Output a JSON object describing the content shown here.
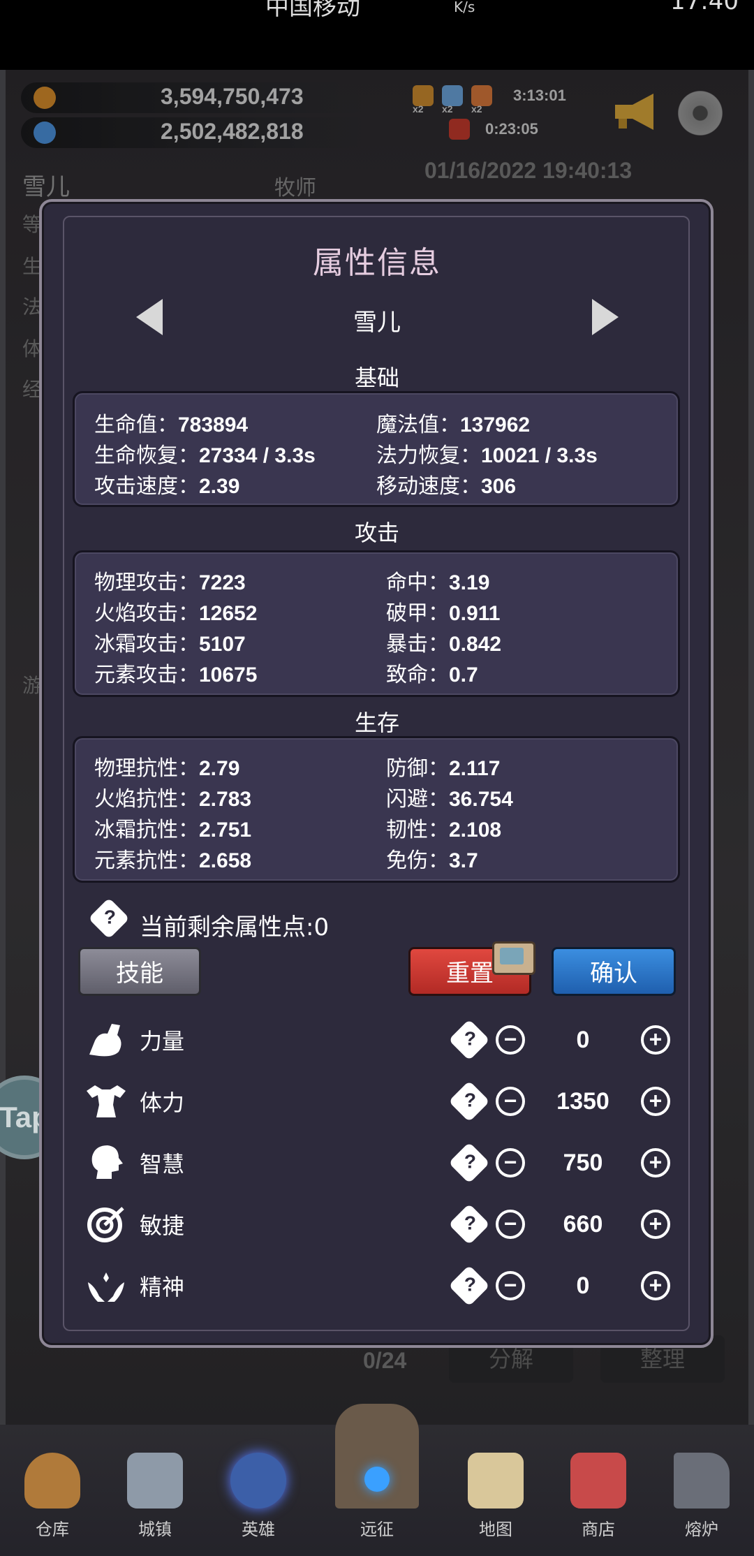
{
  "status_bar": {
    "carrier": "中国移动",
    "net_unit": "K/s",
    "time": "17:40"
  },
  "resources": {
    "gold": "3,594,750,473",
    "gems": "2,502,482,818"
  },
  "buffs": {
    "multiplier_1": "x2",
    "multiplier_2": "x2",
    "multiplier_3": "x2",
    "buff_timer": "3:13:01",
    "gift_timer": "0:23:05"
  },
  "background": {
    "hero_name": "雪儿",
    "hero_class": "牧师",
    "datetime": "01/16/2022 19:40:13",
    "side_labels": [
      "等",
      "生",
      "法",
      "体",
      "经",
      "游"
    ],
    "bag_count": "0/24",
    "decompose": "分解",
    "sort": "整理"
  },
  "tap_button": "Tap",
  "dialog": {
    "title": "属性信息",
    "hero_name": "雪儿",
    "sections": {
      "basic": {
        "title": "基础",
        "stats": [
          {
            "label": "生命值：",
            "value": "783894"
          },
          {
            "label": "魔法值：",
            "value": "137962"
          },
          {
            "label": "生命恢复：",
            "value": "27334 / 3.3s"
          },
          {
            "label": "法力恢复：",
            "value": "10021 / 3.3s"
          },
          {
            "label": "攻击速度：",
            "value": "2.39"
          },
          {
            "label": "移动速度：",
            "value": "306"
          }
        ]
      },
      "attack": {
        "title": "攻击",
        "stats": [
          {
            "label": "物理攻击：",
            "value": "7223"
          },
          {
            "label": "命中：",
            "value": "3.19"
          },
          {
            "label": "火焰攻击：",
            "value": "12652"
          },
          {
            "label": "破甲：",
            "value": "0.911"
          },
          {
            "label": "冰霜攻击：",
            "value": "5107"
          },
          {
            "label": "暴击：",
            "value": "0.842"
          },
          {
            "label": "元素攻击：",
            "value": "10675"
          },
          {
            "label": "致命：",
            "value": "0.7"
          }
        ]
      },
      "survival": {
        "title": "生存",
        "stats": [
          {
            "label": "物理抗性：",
            "value": "2.79"
          },
          {
            "label": "防御：",
            "value": "2.117"
          },
          {
            "label": "火焰抗性：",
            "value": "2.783"
          },
          {
            "label": "闪避：",
            "value": "36.754"
          },
          {
            "label": "冰霜抗性：",
            "value": "2.751"
          },
          {
            "label": "韧性：",
            "value": "2.108"
          },
          {
            "label": "元素抗性：",
            "value": "2.658"
          },
          {
            "label": "免伤：",
            "value": "3.7"
          }
        ]
      }
    },
    "remaining_points": "当前剩余属性点:0",
    "buttons": {
      "skill": "技能",
      "reset": "重置",
      "confirm": "确认"
    },
    "attributes": [
      {
        "name": "力量",
        "value": "0",
        "icon": "strength-icon"
      },
      {
        "name": "体力",
        "value": "1350",
        "icon": "stamina-icon"
      },
      {
        "name": "智慧",
        "value": "750",
        "icon": "wisdom-icon"
      },
      {
        "name": "敏捷",
        "value": "660",
        "icon": "agility-icon"
      },
      {
        "name": "精神",
        "value": "0",
        "icon": "spirit-icon"
      }
    ]
  },
  "bottom_nav": [
    {
      "label": "仓库",
      "color": "#b07a3a"
    },
    {
      "label": "城镇",
      "color": "#8e9aa8"
    },
    {
      "label": "英雄",
      "color": "#3c5fa8"
    },
    {
      "label": "远征",
      "color": "#6a5a4a"
    },
    {
      "label": "地图",
      "color": "#d9c79a"
    },
    {
      "label": "商店",
      "color": "#c84a4a"
    },
    {
      "label": "熔炉",
      "color": "#6a6e78"
    }
  ]
}
